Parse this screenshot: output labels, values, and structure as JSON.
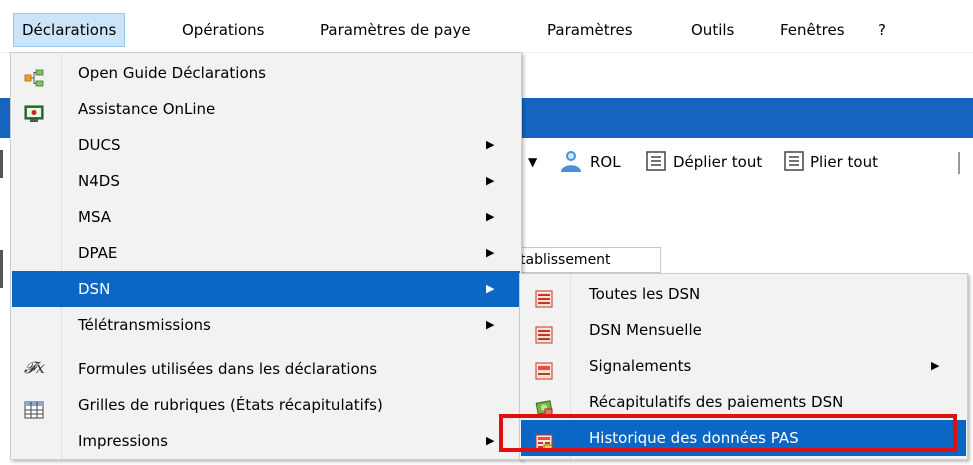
{
  "menubar": {
    "items": [
      {
        "label": "Déclarations",
        "active": true
      },
      {
        "label": "Opérations"
      },
      {
        "label": "Paramètres de paye"
      },
      {
        "label": "Paramètres"
      },
      {
        "label": "Outils"
      },
      {
        "label": "Fenêtres"
      },
      {
        "label": "?"
      }
    ]
  },
  "toolbar": {
    "rol_label": "ROL",
    "unfold_label": "Déplier tout",
    "fold_label": "Plier tout"
  },
  "grid": {
    "column_header": "tablissement"
  },
  "declarations_menu": {
    "items": [
      {
        "label": "Open Guide Déclarations",
        "icon": "tree-icon"
      },
      {
        "label": "Assistance OnLine",
        "icon": "monitor-icon"
      },
      {
        "label": "DUCS",
        "submenu": true
      },
      {
        "label": "N4DS",
        "submenu": true
      },
      {
        "label": "MSA",
        "submenu": true
      },
      {
        "label": "DPAE",
        "submenu": true
      },
      {
        "label": "DSN",
        "submenu": true,
        "selected": true
      },
      {
        "label": "Télétransmissions",
        "submenu": true
      },
      {
        "label": "Formules utilisées dans les déclarations",
        "icon": "fx-icon"
      },
      {
        "label": "Grilles de rubriques (États récapitulatifs)",
        "icon": "grid-icon"
      },
      {
        "label": "Impressions",
        "submenu": true
      }
    ]
  },
  "dsn_submenu": {
    "items": [
      {
        "label": "Toutes les DSN",
        "icon": "document-list-icon"
      },
      {
        "label": "DSN Mensuelle",
        "icon": "document-list-icon"
      },
      {
        "label": "Signalements",
        "icon": "document-flag-icon",
        "submenu": true
      },
      {
        "label": "Récapitulatifs des paiements DSN",
        "icon": "money-icon"
      },
      {
        "label": "Historique des données PAS",
        "icon": "history-table-icon",
        "selected": true
      }
    ]
  },
  "colors": {
    "selection": "#0c67c4",
    "highlight_box": "#e01010",
    "menubar_active": "#cce4f7"
  }
}
